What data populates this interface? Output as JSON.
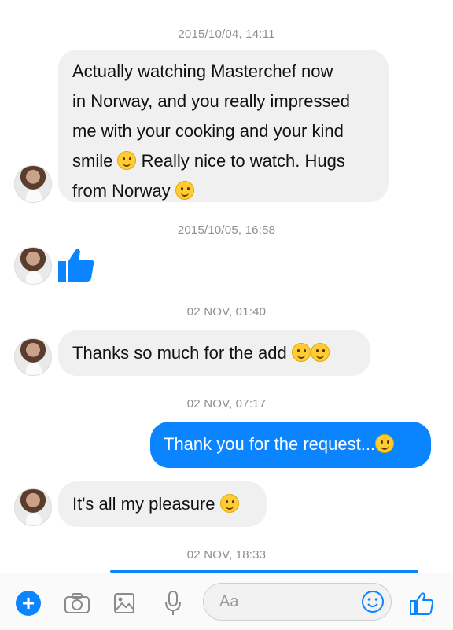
{
  "timestamps": [
    "2015/10/04, 14:11",
    "2015/10/05, 16:58",
    "02 NOV, 01:40",
    "02 NOV, 07:17",
    "02 NOV, 18:33"
  ],
  "messages": {
    "m1": {
      "line1": "Actually watching Masterchef now",
      "line2": "in Norway,  and you really impressed",
      "line3": "me with your cooking and your kind",
      "line4a": "smile",
      "line4b": "Really nice to watch. Hugs",
      "line5": "from Norway"
    },
    "m3": "Thanks so much for the add",
    "m4": "Thank you for the request...",
    "m5": "It's all my pleasure"
  },
  "composer": {
    "placeholder": "Aa"
  },
  "colors": {
    "accent": "#0b84ff",
    "incoming_bubble": "#f0f0f0",
    "timestamp": "#8e8e93"
  },
  "icons": [
    "plus-icon",
    "camera-icon",
    "image-icon",
    "microphone-icon",
    "emoji-icon",
    "thumbs-up-icon"
  ]
}
